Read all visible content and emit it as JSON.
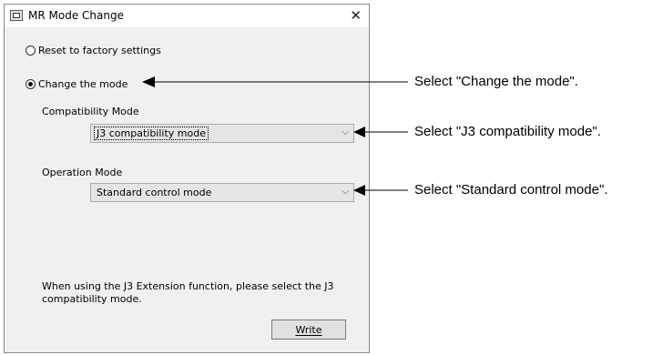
{
  "dialog": {
    "title": "MR Mode Change",
    "reset_label": "Reset to factory settings",
    "change_label": "Change the mode",
    "compat_label": "Compatibility Mode",
    "compat_value": "J3 compatibility mode",
    "operation_label": "Operation Mode",
    "operation_value": "Standard control mode",
    "note": "When using the J3 Extension function, please select the J3 compatibility mode.",
    "write_label": "Write",
    "selected_option": "Change the mode"
  },
  "annotations": {
    "change_mode": "Select \"Change the mode\".",
    "compat_mode": "Select \"J3 compatibility mode\".",
    "standard_mode": "Select \"Standard control mode\"."
  },
  "icons": {
    "app": "app-window-icon",
    "close": "close-icon",
    "dropdown": "chevron-down-icon"
  }
}
